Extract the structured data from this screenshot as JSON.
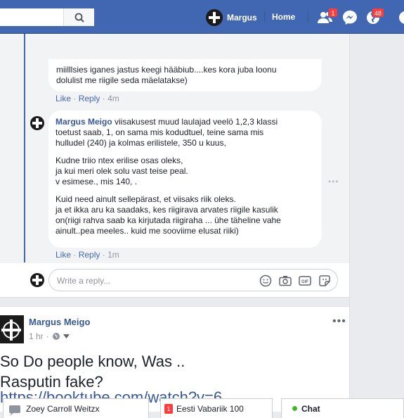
{
  "topbar": {
    "user_name": "Margus",
    "home_label": "Home",
    "friend_requests_count": "1",
    "notifications_count": "48"
  },
  "thread": {
    "comment1_tail_lines": "miilllsies iganes jastus keegi hääbiub....kes kora juba loonu\ndolulist me riigile seda mäelatakse)",
    "comment1_like": "Like",
    "comment1_reply": "Reply",
    "comment1_time": "4m",
    "comment2_author": "Margus Meigo",
    "comment2_text_first": "viisakusest muud laulajad veelö 1,2,3 klassi",
    "comment2_text_rest": "toetust saab, 1, on sama mis kodudtuel, teine sama mis\nhulludel (240) ja kolmas erilistele, 350 u kuus,",
    "comment2_para2": "Kudne triio ntex erilise osas oleks,\nja kui meri olek solu vast teise peal.\nv esimese., mis 140, .",
    "comment2_para3": "Kuid need ainult sellepärast, et viisaks riik oleks.\nja et ikka aru ka saadaks, kes riigirava arvates riigile kasulik\non(riigi rahva saab ka kirjutada riigiraha ... ühe täheline vahe\nainult..pea meeles.. kuid me sooviime elusat riiki)",
    "comment2_like": "Like",
    "comment2_reply": "Reply",
    "comment2_time": "1m",
    "reply_placeholder": "Write a reply..."
  },
  "post": {
    "author": "Margus Meigo",
    "time": "1 hr",
    "text": "So Do people know, Was ..\nRasputin fake?",
    "link_text": "https://booktube.com/watch?v=6"
  },
  "chat": {
    "tab1_label": "Zoey Carroll Weitzx",
    "tab2_count": "1",
    "tab2_label": "Eesti Vabariik 100",
    "chat_label": "Chat"
  },
  "colors": {
    "facebook_blue": "#4267b2",
    "link_blue": "#385898",
    "badge_red": "#fa3e3e",
    "online_green": "#42b72a"
  }
}
